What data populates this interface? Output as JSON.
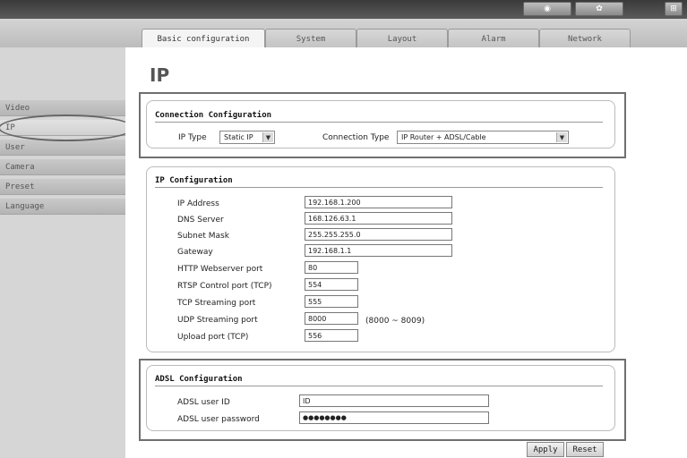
{
  "top_icons": [
    "camera-icon",
    "gear-icon",
    "info-icon"
  ],
  "tabs": [
    {
      "label": "Basic configuration",
      "active": true
    },
    {
      "label": "System",
      "active": false
    },
    {
      "label": "Layout",
      "active": false
    },
    {
      "label": "Alarm",
      "active": false
    },
    {
      "label": "Network",
      "active": false
    }
  ],
  "sidebar": {
    "items": [
      {
        "label": "Video"
      },
      {
        "label": "IP"
      },
      {
        "label": "User"
      },
      {
        "label": "Camera"
      },
      {
        "label": "Preset"
      },
      {
        "label": "Language"
      }
    ]
  },
  "page_title": "IP",
  "connection": {
    "title": "Connection Configuration",
    "ip_type_label": "IP Type",
    "ip_type_value": "Static IP",
    "conn_type_label": "Connection Type",
    "conn_type_value": "IP Router + ADSL/Cable"
  },
  "ipconfig": {
    "title": "IP Configuration",
    "rows": [
      {
        "label": "IP Address",
        "value": "192.168.1.200"
      },
      {
        "label": "DNS Server",
        "value": "168.126.63.1"
      },
      {
        "label": "Subnet Mask",
        "value": "255.255.255.0"
      },
      {
        "label": "Gateway",
        "value": "192.168.1.1"
      },
      {
        "label": "HTTP Webserver port",
        "value": "80"
      },
      {
        "label": "RTSP Control port (TCP)",
        "value": "554"
      },
      {
        "label": "TCP Streaming port",
        "value": "555"
      },
      {
        "label": "UDP Streaming port",
        "value": "8000"
      },
      {
        "label": "Upload port (TCP)",
        "value": "556"
      }
    ],
    "udp_range": "(8000 ~ 8009)"
  },
  "adsl": {
    "title": "ADSL Configuration",
    "user_label": "ADSL user ID",
    "user_value": "ID",
    "pass_label": "ADSL user password",
    "pass_value": "●●●●●●●●"
  },
  "buttons": {
    "apply": "Apply",
    "reset": "Reset"
  }
}
